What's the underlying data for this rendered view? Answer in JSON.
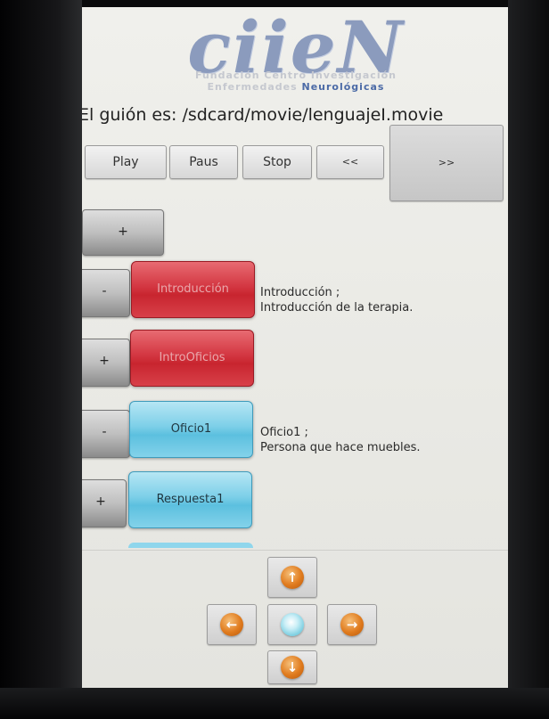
{
  "logo": {
    "text": "ciieN",
    "line1": "Fundación Centro Investigación",
    "line2_prefix": "Enfermedades",
    "line2_accent": "Neurológicas"
  },
  "script_line": "El guión es: /sdcard/movie/lenguajeI.movie",
  "controls": {
    "play": "Play",
    "pause": "Paus",
    "stop": "Stop",
    "rewind": "<<",
    "forward": ">>"
  },
  "top_add": "+",
  "items": [
    {
      "toggle": "-",
      "label": "Introducción",
      "desc_title": "Introducción ;",
      "desc_body": "Introducción de la terapia."
    },
    {
      "toggle": "+",
      "label": "IntroOficios"
    },
    {
      "toggle": "-",
      "label": "Oficio1",
      "desc_title": "Oficio1 ;",
      "desc_body": "Persona que hace muebles."
    },
    {
      "toggle": "+",
      "label": "Respuesta1"
    }
  ],
  "colors": {
    "red_item": "#d33641",
    "blue_item": "#7ccfe8",
    "nav_orb": "#e07b1e"
  },
  "nav": {
    "up": "up-arrow-icon",
    "left": "left-arrow-icon",
    "center": "center-select-icon",
    "right": "right-arrow-icon",
    "down": "down-arrow-icon"
  }
}
